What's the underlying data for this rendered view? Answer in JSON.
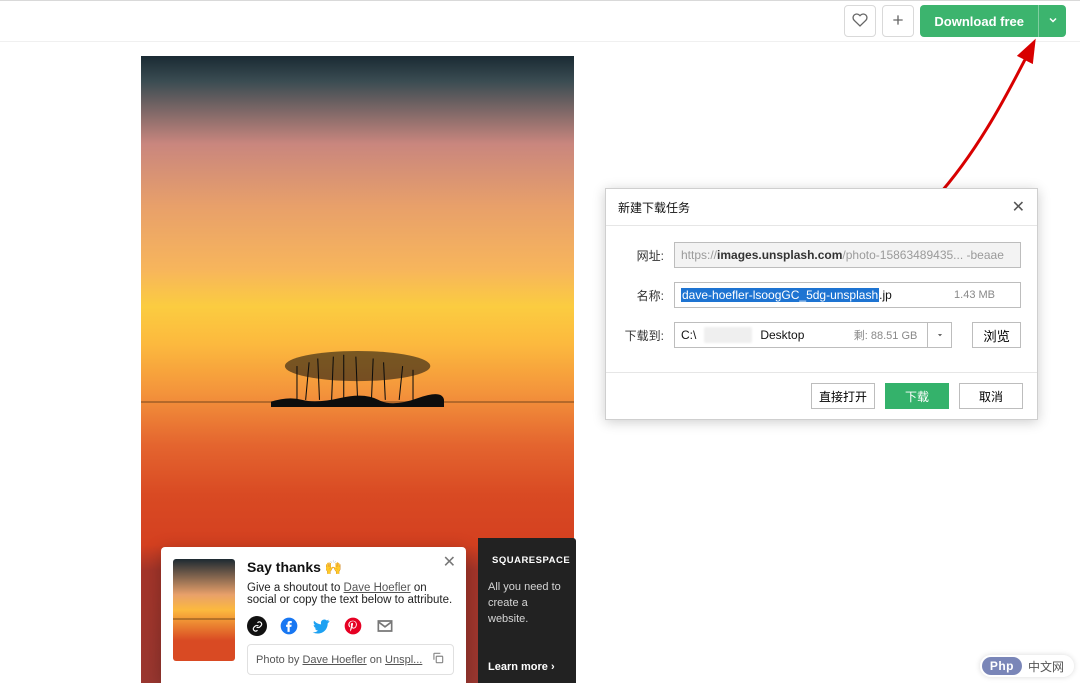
{
  "topbar": {
    "download_label": "Download free"
  },
  "thanks": {
    "title": "Say thanks 🙌",
    "text_prefix": "Give a shoutout to ",
    "author": "Dave Hoefler",
    "text_suffix": " on social or copy the text below to attribute.",
    "credit_prefix": "Photo by ",
    "credit_author": "Dave Hoefler",
    "credit_middle": " on ",
    "credit_site": "Unspl..."
  },
  "squarespace": {
    "brand": "SQUARESPACE",
    "tagline": "All you need to create a website.",
    "cta": "Learn more ›"
  },
  "dialog": {
    "title": "新建下载任务",
    "url_label": "网址:",
    "url_prefix": "https://",
    "url_host": "images.unsplash.com",
    "url_rest": "/photo-15863489435... -beaae",
    "name_label": "名称:",
    "name_highlight": "dave-hoefler-lsoogGC_5dg-unsplash",
    "name_ext": ".jp",
    "size": "1.43 MB",
    "path_label": "下载到:",
    "path_prefix": "C:\\",
    "path_suffix": "Desktop",
    "remaining_prefix": "剩:",
    "remaining_value": "88.51 GB",
    "browse": "浏览",
    "open": "直接打开",
    "download": "下载",
    "cancel": "取消"
  },
  "badge": {
    "pill": "Php",
    "text": "中文网"
  }
}
